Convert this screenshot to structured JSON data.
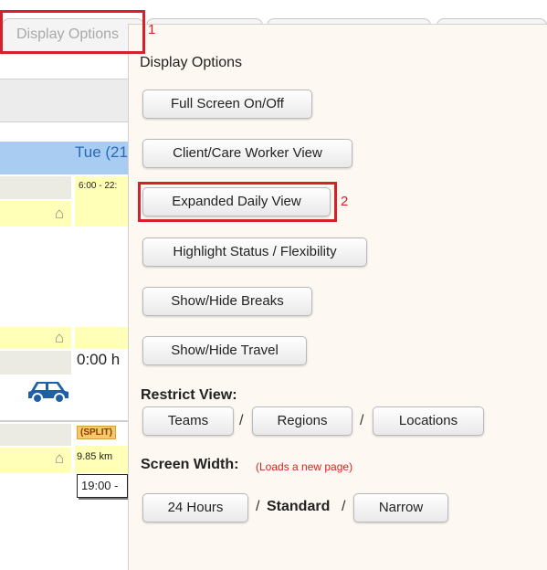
{
  "tabs": {
    "active_label": "Display Options"
  },
  "calendar": {
    "day_label": "Tue (21",
    "time_range": "6:00 - 22:",
    "hours": "0:00 h",
    "split_label": "(SPLIT)",
    "distance": "9.85 km",
    "time_box": "19:00 - "
  },
  "panel": {
    "title": "Display Options",
    "buttons": {
      "full_screen": "Full Screen On/Off",
      "client_care_worker": "Client/Care Worker View",
      "expanded_daily": "Expanded Daily View",
      "highlight_status": "Highlight Status / Flexibility",
      "breaks": "Show/Hide Breaks",
      "travel": "Show/Hide Travel"
    },
    "restrict_view": {
      "label": "Restrict View:",
      "teams": "Teams",
      "regions": "Regions",
      "locations": "Locations",
      "sep": "/"
    },
    "screen_width": {
      "label": "Screen Width:",
      "note": "(Loads a new page)",
      "hours24": "24 Hours",
      "standard": "Standard",
      "narrow": "Narrow",
      "sep": "/"
    }
  },
  "annotations": {
    "marker1": "1",
    "marker2": "2"
  },
  "colors": {
    "annotation": "#d6202a",
    "day_band": "#a8ccf2",
    "panel_bg": "#fdf8f2",
    "car": "#1f5fa8"
  }
}
